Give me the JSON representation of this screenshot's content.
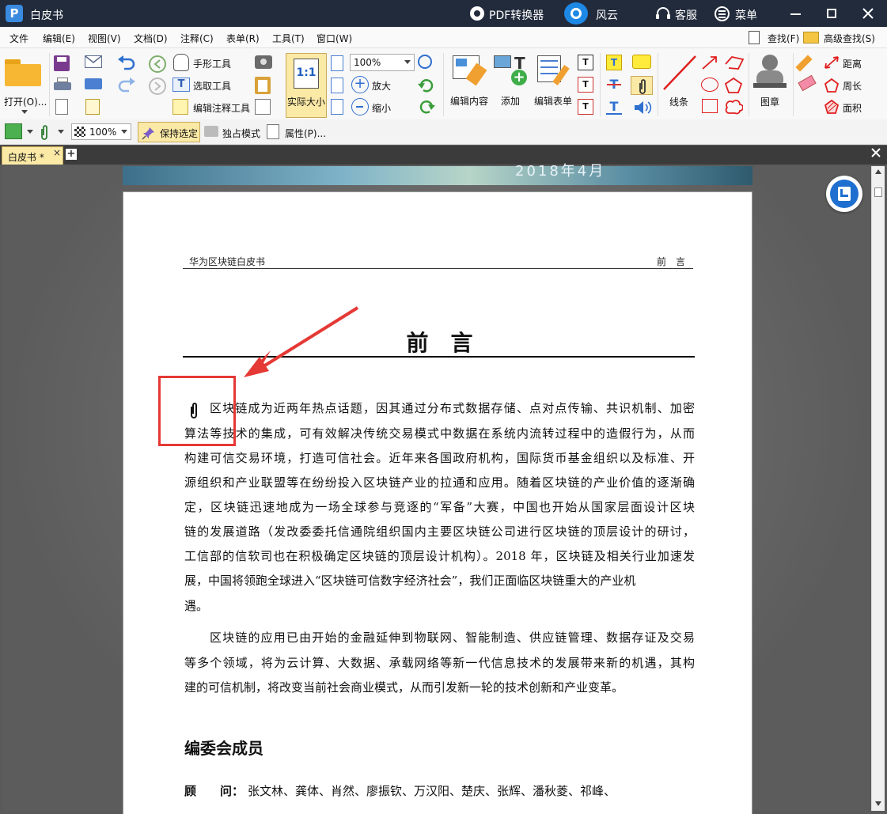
{
  "titlebar": {
    "doc_title": "白皮书",
    "pdf_converter": "PDF转换器",
    "fengyun": "风云",
    "service": "客服",
    "menu": "菜单"
  },
  "menubar": {
    "items": [
      "文件",
      "编辑(E)",
      "视图(V)",
      "文档(D)",
      "注释(C)",
      "表单(R)",
      "工具(T)",
      "窗口(W)"
    ],
    "find": "查找(F)",
    "advanced_find": "高级查找(S)"
  },
  "ribbon": {
    "open": "打开(O)...",
    "hand_tool": "手形工具",
    "select_tool": "选取工具",
    "edit_annot_tool": "编辑注释工具",
    "actual_size_glyph": "1:1",
    "actual_size": "实际大小",
    "zoom_value": "100%",
    "zoom_in": "放大",
    "zoom_out": "缩小",
    "edit_content": "编辑内容",
    "add": "添加",
    "edit_form": "编辑表单",
    "lines": "线条",
    "stamp": "图章",
    "distance": "距离",
    "perimeter": "周长",
    "area": "面积"
  },
  "toolbar2": {
    "opacity": "100%",
    "keep_selected": "保持选定",
    "exclusive_mode": "独占模式",
    "properties": "属性(P)..."
  },
  "tabs": {
    "active": "白皮书 *",
    "close_glyph": "×",
    "add_glyph": "+"
  },
  "document": {
    "cover_date": "2018年4月",
    "header_left": "华为区块链白皮书",
    "header_right": "前　言",
    "title": "前言",
    "paragraph1_lines": [
      "区块链成为近两年热点话题，因其通过分布式数据存储、点对点传输、共识机制、加密",
      "算法等技术的集成，可有效解决传统交易模式中数据在系统内流转过程中的造假行为，从而",
      "构建可信交易环境，打造可信社会。近年来各国政府机构，国际货币基金组织以及标准、开",
      "源组织和产业联盟等在纷纷投入区块链产业的拉通和应用。随着区块链的产业价值的逐渐确",
      "定，区块链迅速地成为一场全球参与竞逐的“军备”大赛，中国也开始从国家层面设计区块",
      "链的发展道路（发改委委托信通院组织国内主要区块链公司进行区块链的顶层设计的研讨，",
      "工信部的信软司也在积极确定区块链的顶层设计机构）。2018 年，区块链及相关行业加速发",
      "展，中国将领跑全球进入“区块链可信数字经济社会”，我们正面临区块链重大的产业机",
      "遇。"
    ],
    "paragraph2_lines": [
      "区块链的应用已由开始的金融延伸到物联网、智能制造、供应链管理、数据存证及交易",
      "等多个领域，将为云计算、大数据、承载网络等新一代信息技术的发展带来新的机遇，其构",
      "建的可信机制，将改变当前社会商业模式，从而引发新一轮的技术创新和产业变革。"
    ],
    "section_title": "编委会成员",
    "advisor_label": "顾　　问：",
    "advisor_names": "张文林、龚体、肖然、廖振钦、万汉阳、楚庆、张辉、潘秋菱、祁峰、"
  },
  "colors": {
    "titlebar_bg": "#222b3c",
    "active_tab": "#fbe9a6",
    "highlight_box": "#e53935",
    "arrow": "#e53935"
  }
}
